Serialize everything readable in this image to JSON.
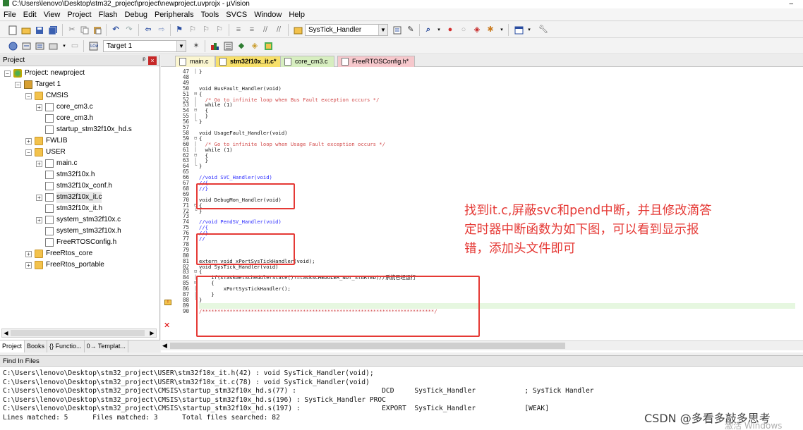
{
  "window": {
    "title": "C:\\Users\\lenovo\\Desktop\\stm32_project\\project\\newproject.uvprojx - µVision",
    "minimize": "–"
  },
  "menu": [
    "File",
    "Edit",
    "View",
    "Project",
    "Flash",
    "Debug",
    "Peripherals",
    "Tools",
    "SVCS",
    "Window",
    "Help"
  ],
  "toolbar1": {
    "find_combo": "SysTick_Handler"
  },
  "toolbar2": {
    "target_combo": "Target 1"
  },
  "project_panel": {
    "title": "Project",
    "pin": "ᵖ",
    "close": "×",
    "tree": [
      {
        "label": "Project: newproject",
        "level": 0,
        "kind": "project",
        "expander": "−"
      },
      {
        "label": "Target 1",
        "level": 1,
        "kind": "target",
        "expander": "−"
      },
      {
        "label": "CMSIS",
        "level": 2,
        "kind": "folder",
        "expander": "−"
      },
      {
        "label": "core_cm3.c",
        "level": 3,
        "kind": "file",
        "expander": "+"
      },
      {
        "label": "core_cm3.h",
        "level": 3,
        "kind": "file",
        "expander": ""
      },
      {
        "label": "startup_stm32f10x_hd.s",
        "level": 3,
        "kind": "file",
        "expander": ""
      },
      {
        "label": "FWLIB",
        "level": 2,
        "kind": "folder",
        "expander": "+"
      },
      {
        "label": "USER",
        "level": 2,
        "kind": "folder",
        "expander": "−"
      },
      {
        "label": "main.c",
        "level": 3,
        "kind": "file",
        "expander": "+"
      },
      {
        "label": "stm32f10x.h",
        "level": 3,
        "kind": "file",
        "expander": ""
      },
      {
        "label": "stm32f10x_conf.h",
        "level": 3,
        "kind": "file",
        "expander": ""
      },
      {
        "label": "stm32f10x_it.c",
        "level": 3,
        "kind": "file",
        "expander": "+",
        "selected": true
      },
      {
        "label": "stm32f10x_it.h",
        "level": 3,
        "kind": "file",
        "expander": ""
      },
      {
        "label": "system_stm32f10x.c",
        "level": 3,
        "kind": "file",
        "expander": "+"
      },
      {
        "label": "system_stm32f10x.h",
        "level": 3,
        "kind": "file",
        "expander": ""
      },
      {
        "label": "FreeRTOSConfig.h",
        "level": 3,
        "kind": "file",
        "expander": ""
      },
      {
        "label": "FreeRtos_core",
        "level": 2,
        "kind": "folder",
        "expander": "+"
      },
      {
        "label": "FreeRtos_portable",
        "level": 2,
        "kind": "folder",
        "expander": "+"
      }
    ],
    "tabs": [
      "Project",
      "Books",
      "{} Functio...",
      "0→ Templat..."
    ]
  },
  "editor": {
    "tabs": [
      "main.c",
      "stm32f10x_it.c*",
      "core_cm3.c",
      "FreeRTOSConfig.h*"
    ],
    "active_tab": "stm32f10x_it.c*",
    "lines": [
      {
        "n": "47",
        "f": "|",
        "t": "}",
        "s": ""
      },
      {
        "n": "48",
        "f": "",
        "t": "",
        "s": ""
      },
      {
        "n": "49",
        "f": "",
        "t": "",
        "s": ""
      },
      {
        "n": "50",
        "f": "",
        "t": "void BusFault_Handler(void)",
        "s": ""
      },
      {
        "n": "51",
        "f": "⊟",
        "t": "{",
        "s": ""
      },
      {
        "n": "52",
        "f": "|",
        "t": "  /* Go to infinite loop when Bus Fault exception occurs */",
        "s": "comment"
      },
      {
        "n": "53",
        "f": "|",
        "t": "  while (1)",
        "s": ""
      },
      {
        "n": "54",
        "f": "⊟",
        "t": "  {",
        "s": ""
      },
      {
        "n": "55",
        "f": "|",
        "t": "  }",
        "s": ""
      },
      {
        "n": "56",
        "f": "└",
        "t": "}",
        "s": ""
      },
      {
        "n": "57",
        "f": "",
        "t": "",
        "s": ""
      },
      {
        "n": "58",
        "f": "",
        "t": "void UsageFault_Handler(void)",
        "s": ""
      },
      {
        "n": "59",
        "f": "⊟",
        "t": "{",
        "s": ""
      },
      {
        "n": "60",
        "f": "|",
        "t": "  /* Go to infinite loop when Usage Fault exception occurs */",
        "s": "comment"
      },
      {
        "n": "61",
        "f": "|",
        "t": "  while (1)",
        "s": ""
      },
      {
        "n": "62",
        "f": "⊟",
        "t": "  {",
        "s": ""
      },
      {
        "n": "63",
        "f": "|",
        "t": "  }",
        "s": ""
      },
      {
        "n": "64",
        "f": "└",
        "t": "}",
        "s": ""
      },
      {
        "n": "65",
        "f": "",
        "t": "",
        "s": ""
      },
      {
        "n": "66",
        "f": "",
        "t": "//void SVC_Handler(void)",
        "s": "comment-blue"
      },
      {
        "n": "67",
        "f": "",
        "t": "//{",
        "s": "comment-blue"
      },
      {
        "n": "68",
        "f": "",
        "t": "//}",
        "s": "comment-blue"
      },
      {
        "n": "69",
        "f": "",
        "t": "",
        "s": ""
      },
      {
        "n": "70",
        "f": "",
        "t": "void DebugMon_Handler(void)",
        "s": ""
      },
      {
        "n": "71",
        "f": "⊟",
        "t": "{",
        "s": ""
      },
      {
        "n": "72",
        "f": "└",
        "t": "}",
        "s": ""
      },
      {
        "n": "73",
        "f": "",
        "t": "",
        "s": ""
      },
      {
        "n": "74",
        "f": "",
        "t": "//void PendSV_Handler(void)",
        "s": "comment-blue"
      },
      {
        "n": "75",
        "f": "",
        "t": "//{",
        "s": "comment-blue"
      },
      {
        "n": "76",
        "f": "",
        "t": "//}",
        "s": "comment-blue"
      },
      {
        "n": "77",
        "f": "",
        "t": "//",
        "s": "comment-blue"
      },
      {
        "n": "78",
        "f": "",
        "t": "",
        "s": ""
      },
      {
        "n": "79",
        "f": "",
        "t": "",
        "s": ""
      },
      {
        "n": "80",
        "f": "",
        "t": "",
        "s": ""
      },
      {
        "n": "81",
        "f": "",
        "t": "extern void xPortSysTickHandler(void);",
        "s": ""
      },
      {
        "n": "82",
        "f": "",
        "t": "void SysTick_Handler(void)",
        "s": ""
      },
      {
        "n": "83",
        "f": "⊟",
        "t": "{",
        "s": ""
      },
      {
        "n": "84",
        "f": "|",
        "t": "    if(xTaskGetSchedulerState()!=taskSCHEDULER_NOT_STARTED)//系统已经运行",
        "s": ""
      },
      {
        "n": "85",
        "f": "⊟",
        "t": "    {",
        "s": ""
      },
      {
        "n": "86",
        "f": "|",
        "t": "        xPortSysTickHandler();",
        "s": ""
      },
      {
        "n": "87",
        "f": "|",
        "t": "    }",
        "s": ""
      },
      {
        "n": "88",
        "f": "└",
        "t": "}",
        "s": ""
      },
      {
        "n": "89",
        "f": "",
        "t": "",
        "s": ""
      },
      {
        "n": "90",
        "f": "",
        "t": "/****************************************************************************/",
        "s": "comment"
      }
    ],
    "annotation": "找到it.c,屏蔽svc和pend中断，并且修改滴答定时器中断函数为如下图，可以看到显示报错，添加头文件即可",
    "warning_mark": "!",
    "error_mark": "✕"
  },
  "find_panel": {
    "title": "Find In Files",
    "results": [
      "C:\\Users\\lenovo\\Desktop\\stm32_project\\USER\\stm32f10x_it.h(42) : void SysTick_Handler(void);",
      "C:\\Users\\lenovo\\Desktop\\stm32_project\\USER\\stm32f10x_it.c(78) : void SysTick_Handler(void)",
      "C:\\Users\\lenovo\\Desktop\\stm32_project\\CMSIS\\startup_stm32f10x_hd.s(77) :                     DCD     SysTick_Handler            ; SysTick Handler",
      "C:\\Users\\lenovo\\Desktop\\stm32_project\\CMSIS\\startup_stm32f10x_hd.s(196) : SysTick_Handler PROC",
      "C:\\Users\\lenovo\\Desktop\\stm32_project\\CMSIS\\startup_stm32f10x_hd.s(197) :                    EXPORT  SysTick_Handler            [WEAK]",
      "Lines matched: 5      Files matched: 3      Total files searched: 82"
    ]
  },
  "watermark": "CSDN @多看多敲多思考",
  "activate_windows": "激活 Windows"
}
